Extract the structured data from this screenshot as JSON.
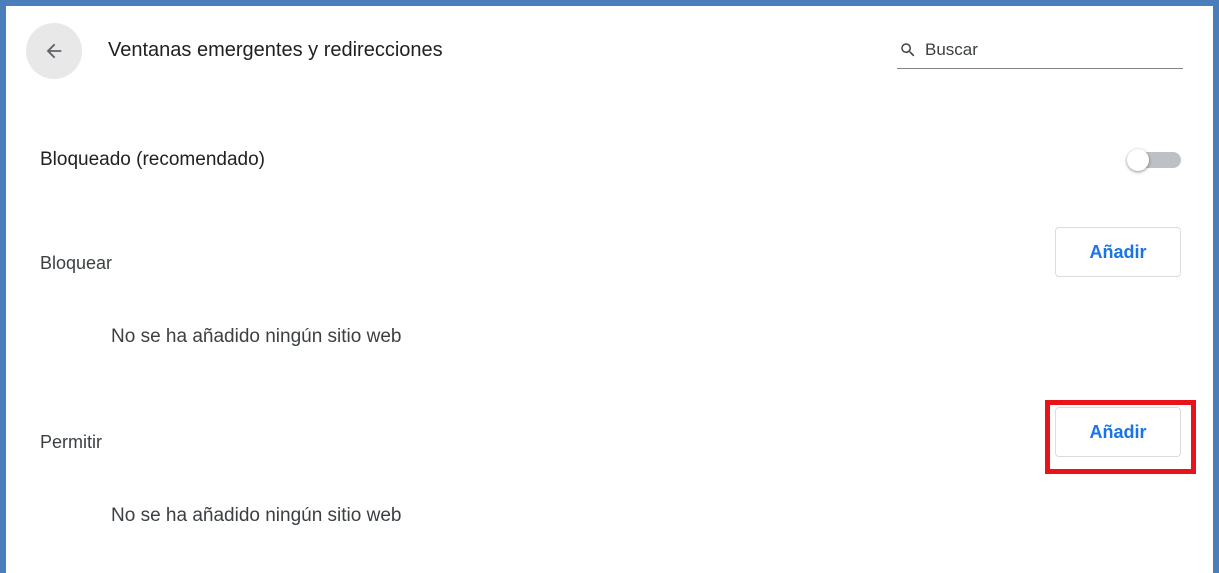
{
  "header": {
    "title": "Ventanas emergentes y redirecciones",
    "search_placeholder": "Buscar"
  },
  "blocked_setting": {
    "label": "Bloqueado (recomendado)",
    "enabled": false
  },
  "block_section": {
    "label": "Bloquear",
    "add_label": "Añadir",
    "empty_text": "No se ha añadido ningún sitio web"
  },
  "allow_section": {
    "label": "Permitir",
    "add_label": "Añadir",
    "empty_text": "No se ha añadido ningún sitio web"
  },
  "colors": {
    "frame_border": "#4a7ebb",
    "accent_blue": "#1a73e8",
    "highlight_red": "#e8141a"
  },
  "icons": {
    "back": "back-arrow-icon",
    "search": "search-icon"
  }
}
